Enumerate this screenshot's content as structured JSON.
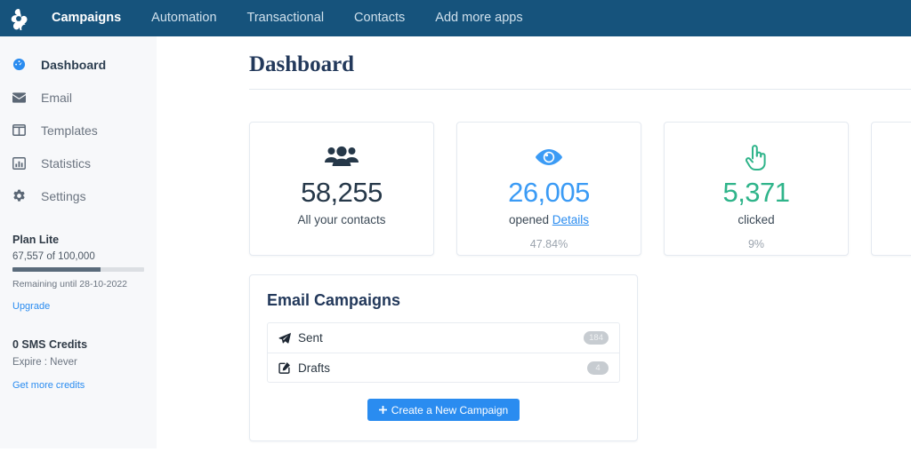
{
  "topnav": {
    "logo_icon": "pinwheel-logo-icon",
    "background": "#16537c",
    "items": [
      {
        "label": "Campaigns",
        "active": true
      },
      {
        "label": "Automation",
        "active": false
      },
      {
        "label": "Transactional",
        "active": false
      },
      {
        "label": "Contacts",
        "active": false
      },
      {
        "label": "Add more apps",
        "active": false
      }
    ]
  },
  "sidebar": {
    "items": [
      {
        "label": "Dashboard",
        "icon": "speedometer-icon",
        "active": true
      },
      {
        "label": "Email",
        "icon": "envelope-icon",
        "active": false
      },
      {
        "label": "Templates",
        "icon": "columns-icon",
        "active": false
      },
      {
        "label": "Statistics",
        "icon": "bar-chart-icon",
        "active": false
      },
      {
        "label": "Settings",
        "icon": "gear-icon",
        "active": false
      }
    ],
    "plan": {
      "title": "Plan Lite",
      "usage": "67,557 of 100,000",
      "progress_percent": 67,
      "remaining": "Remaining until 28-10-2022",
      "upgrade_label": "Upgrade"
    },
    "sms": {
      "title": "0 SMS Credits",
      "expire": "Expire : Never",
      "get_more_label": "Get more credits"
    }
  },
  "main": {
    "page_title": "Dashboard",
    "cards": [
      {
        "icon": "users-group-icon",
        "icon_color": "#263849",
        "value": "58,255",
        "value_color": "#263849",
        "label": "All your contacts",
        "sub": ""
      },
      {
        "icon": "eye-icon",
        "icon_color": "#3b9bf5",
        "value": "26,005",
        "value_color": "#3b9bf5",
        "label": "opened",
        "link_label": "Details",
        "sub": "47.84%"
      },
      {
        "icon": "pointing-hand-icon",
        "icon_color": "#2fb48a",
        "value": "5,371",
        "value_color": "#2fb48a",
        "label": "clicked",
        "sub": "9%"
      },
      {
        "icon": "",
        "value": "",
        "label": "",
        "sub": ""
      }
    ],
    "panel": {
      "title": "Email Campaigns",
      "rows": [
        {
          "label": "Sent",
          "icon": "paper-plane-icon",
          "badge": "184"
        },
        {
          "label": "Drafts",
          "icon": "pencil-square-icon",
          "badge": "4"
        }
      ],
      "cta_label": "Create a New Campaign",
      "cta_icon": "plus-icon",
      "cta_color": "#2a8cf0"
    }
  }
}
